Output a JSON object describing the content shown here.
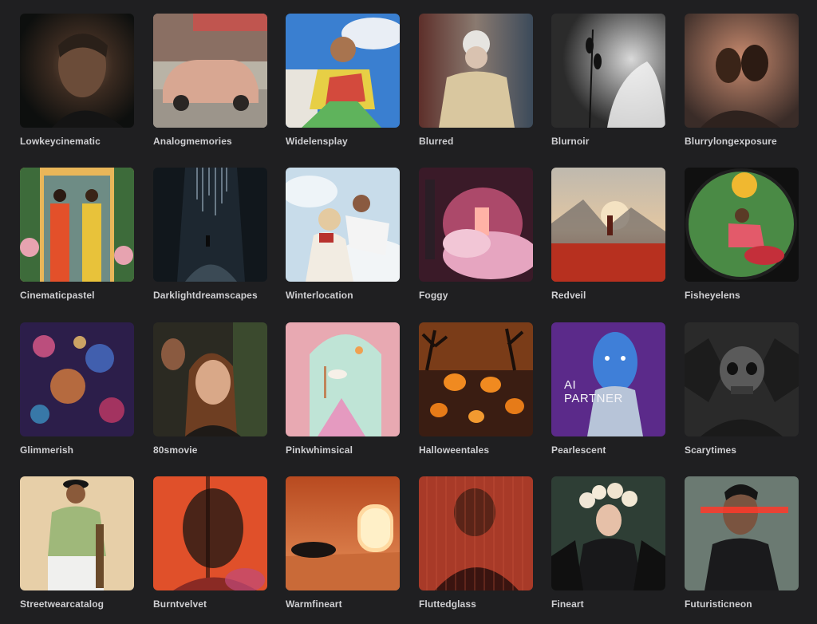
{
  "styles": [
    {
      "name": "Lowkeycinematic"
    },
    {
      "name": "Analogmemories"
    },
    {
      "name": "Widelensplay"
    },
    {
      "name": "Blurred"
    },
    {
      "name": "Blurnoir"
    },
    {
      "name": "Blurrylongexposure"
    },
    {
      "name": "Cinematicpastel"
    },
    {
      "name": "Darklightdreamscapes"
    },
    {
      "name": "Winterlocation"
    },
    {
      "name": "Foggy"
    },
    {
      "name": "Redveil"
    },
    {
      "name": "Fisheyelens"
    },
    {
      "name": "Glimmerish"
    },
    {
      "name": "80smovie"
    },
    {
      "name": "Pinkwhimsical"
    },
    {
      "name": "Halloweentales"
    },
    {
      "name": "Pearlescent",
      "overlay_line1": "AI",
      "overlay_line2": "PARTNER"
    },
    {
      "name": "Scarytimes"
    },
    {
      "name": "Streetwearcatalog"
    },
    {
      "name": "Burntvelvet"
    },
    {
      "name": "Warmfineart"
    },
    {
      "name": "Fluttedglass"
    },
    {
      "name": "Fineart"
    },
    {
      "name": "Futuristicneon"
    }
  ]
}
